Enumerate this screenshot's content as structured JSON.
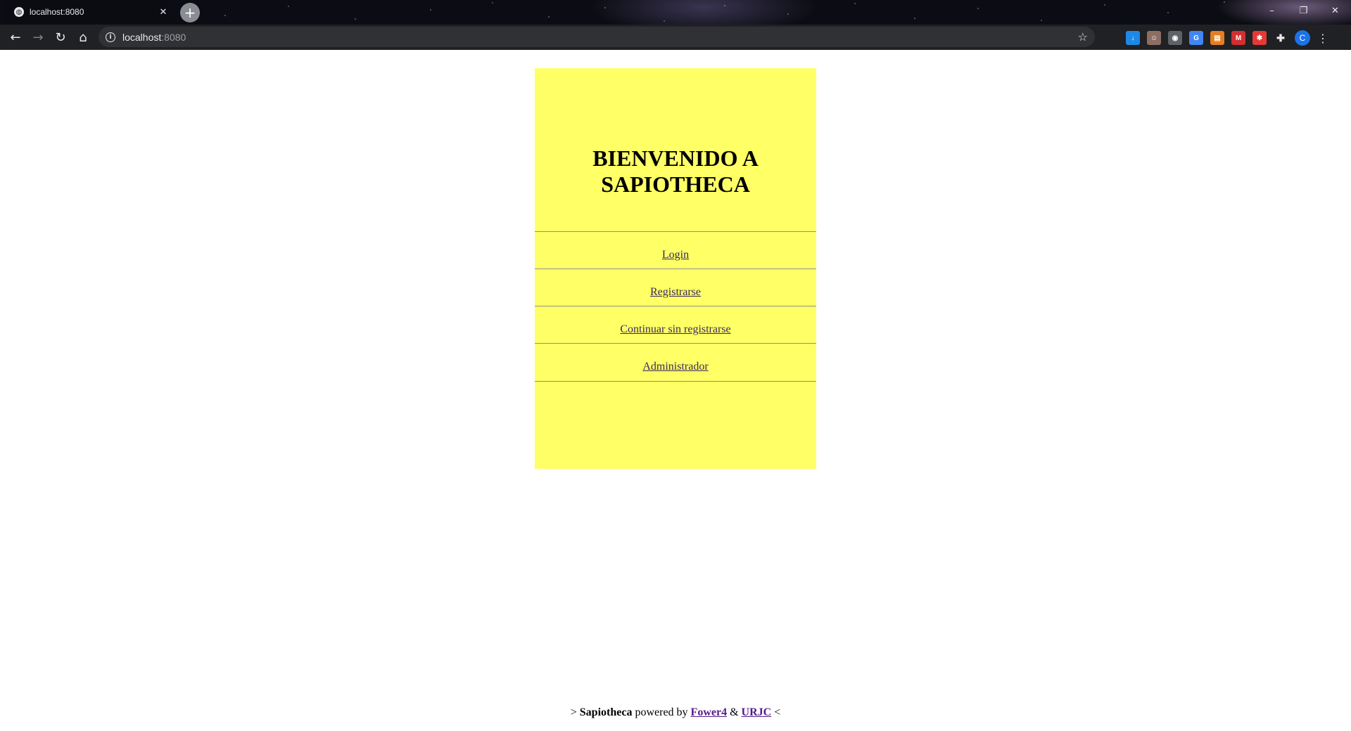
{
  "browser": {
    "tab_title": "localhost:8080",
    "url_host": "localhost",
    "url_port": ":8080"
  },
  "page": {
    "heading_line1": "BIENVENIDO A",
    "heading_line2": "SAPIOTHECA",
    "panel_color": "#ffff66",
    "menu": [
      {
        "label": "Login"
      },
      {
        "label": "Registrarse"
      },
      {
        "label": "Continuar sin registrarse"
      },
      {
        "label": "Administrador"
      }
    ]
  },
  "footer": {
    "prefix": ">",
    "brand": "Sapiotheca",
    "powered_by": "powered by",
    "link1": "Fower4",
    "amp": "&",
    "link2": "URJC",
    "suffix": "<"
  }
}
